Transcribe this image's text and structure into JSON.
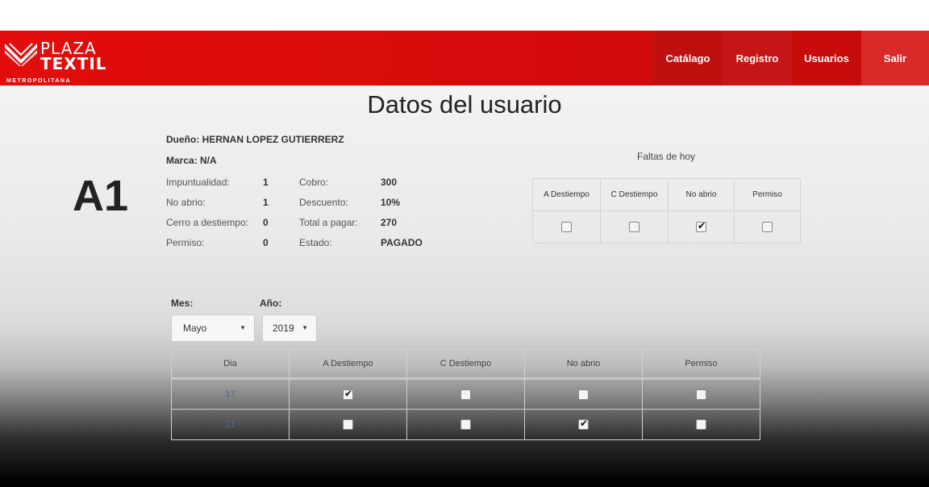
{
  "brand": {
    "line1": "PLAZA",
    "line2": "TEXTIL",
    "line3": "METROPOLITANA"
  },
  "nav": {
    "catalogo": "Catálago",
    "registro": "Registro",
    "usuarios": "Usuarios",
    "salir": "Salir"
  },
  "page_title": "Datos del usuario",
  "user": {
    "owner": "Dueño: HERNAN LOPEZ GUTIERRERZ",
    "brand": "Marca: N/A",
    "code": "A1"
  },
  "stats": [
    {
      "label1": "Impuntualidad:",
      "value1": "1",
      "label2": "Cobro:",
      "value2": "300"
    },
    {
      "label1": "No abrio:",
      "value1": "1",
      "label2": "Descuento:",
      "value2": "10%"
    },
    {
      "label1": "Cerro a destiempo:",
      "value1": "0",
      "label2": "Total a pagar:",
      "value2": "270"
    },
    {
      "label1": "Permiso:",
      "value1": "0",
      "label2": "Estado:",
      "value2": "PAGADO"
    }
  ],
  "faltas_hoy": {
    "label": "Faltas de hoy",
    "headers": [
      "A Destiempo",
      "C Destiempo",
      "No abrio",
      "Permiso"
    ],
    "checked": [
      false,
      false,
      true,
      false
    ]
  },
  "filters": {
    "mes_label": "Mes:",
    "mes_value": "Mayo",
    "anio_label": "Año:",
    "anio_value": "2019"
  },
  "month_table": {
    "headers": [
      "Dia",
      "A Destiempo",
      "C Destiempo",
      "No abrio",
      "Permiso"
    ],
    "rows": [
      {
        "day": "17",
        "checked": [
          true,
          false,
          false,
          false
        ]
      },
      {
        "day": "21",
        "checked": [
          false,
          false,
          true,
          false
        ]
      }
    ]
  },
  "colors": {
    "navbar": "#d40a0a",
    "accent_dark": "#bf1010"
  }
}
